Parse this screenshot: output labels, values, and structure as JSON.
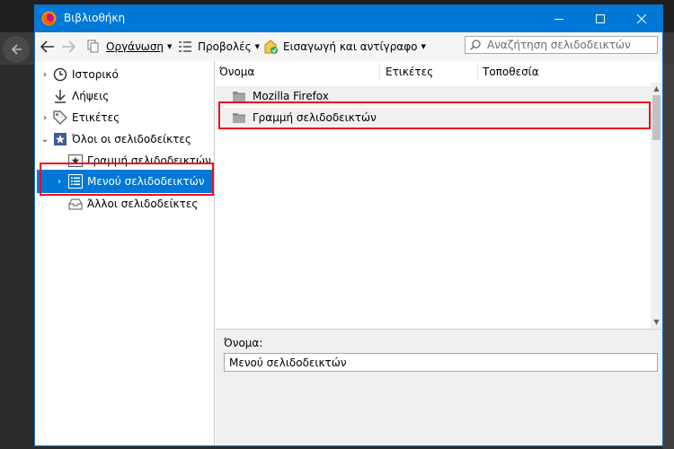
{
  "window": {
    "title": "Βιβλιοθήκη",
    "accent_color": "#0078d7",
    "controls": [
      "minimize-icon",
      "maximize-icon",
      "close-icon"
    ]
  },
  "toolbar": {
    "organize_label": "Οργάνωση",
    "views_label": "Προβολές",
    "import_label": "Εισαγωγή και αντίγραφο",
    "search_placeholder": "Αναζήτηση σελιδοδεικτών"
  },
  "sidebar": {
    "items": [
      {
        "label": "Ιστορικό",
        "icon": "clock-icon",
        "twisty": "›"
      },
      {
        "label": "Λήψεις",
        "icon": "download-icon",
        "twisty": ""
      },
      {
        "label": "Ετικέτες",
        "icon": "tag-icon",
        "twisty": "›"
      },
      {
        "label": "Όλοι οι σελιδοδείκτες",
        "icon": "bookmarks-star-icon",
        "twisty": "⌄"
      },
      {
        "label": "Γραμμή σελιδοδεικτών",
        "icon": "bookmark-star-icon",
        "twisty": ""
      },
      {
        "label": "Μενού σελιδοδεικτών",
        "icon": "bookmarks-menu-icon",
        "twisty": "›",
        "selected": true
      },
      {
        "label": "Άλλοι σελιδοδείκτες",
        "icon": "other-bookmarks-icon",
        "twisty": ""
      }
    ]
  },
  "columns": [
    "Όνομα",
    "Ετικέτες",
    "Τοποθεσία"
  ],
  "rows": [
    {
      "name": "Mozilla Firefox",
      "icon": "folder-icon"
    },
    {
      "name": "Γραμμή σελιδοδεικτών",
      "icon": "folder-icon"
    }
  ],
  "details": {
    "name_label": "Όνομα:",
    "name_value": "Μενού σελιδοδεικτών"
  },
  "highlight_color": "#e81123"
}
